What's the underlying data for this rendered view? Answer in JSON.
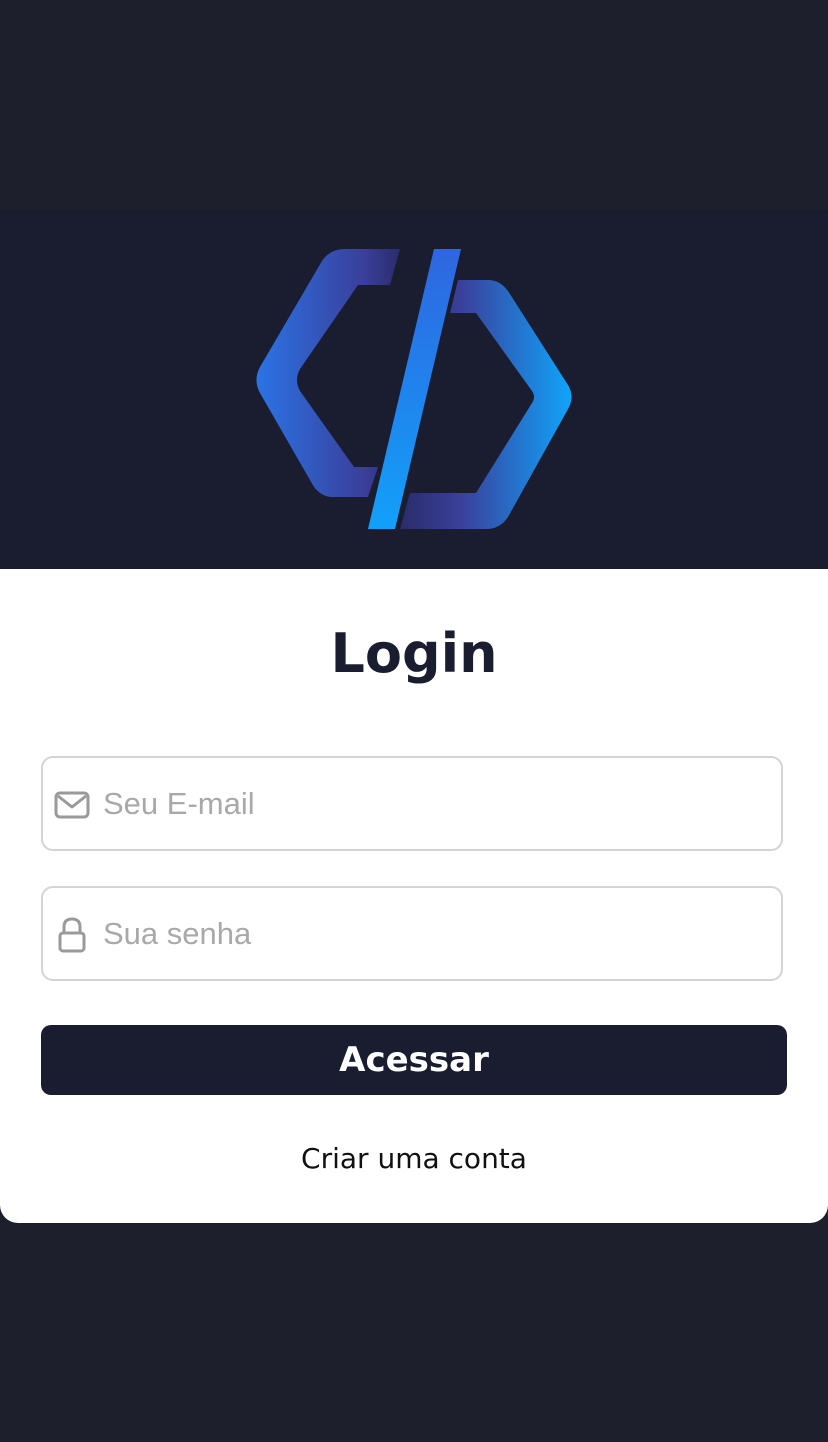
{
  "logo": {
    "icon": "code-brackets-logo",
    "gradient_start": "#3b4fd6",
    "gradient_end": "#12a0fa"
  },
  "login": {
    "title": "Login",
    "email": {
      "placeholder": "Seu E-mail",
      "value": "",
      "icon": "mail-icon"
    },
    "password": {
      "placeholder": "Sua senha",
      "value": "",
      "icon": "lock-icon"
    },
    "submit_label": "Acessar",
    "create_account_label": "Criar uma conta"
  },
  "colors": {
    "background": "#1d202c",
    "header_band": "#1a1d30",
    "primary": "#1a1d30",
    "card": "#ffffff"
  }
}
